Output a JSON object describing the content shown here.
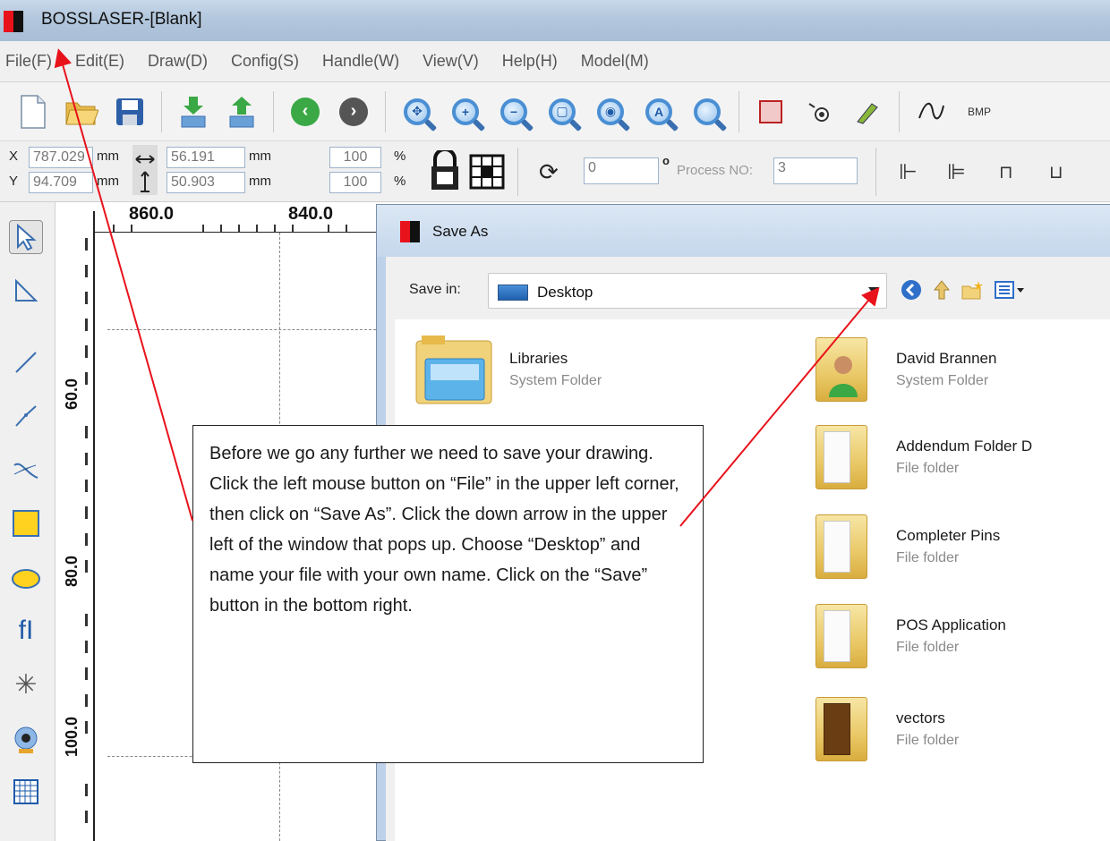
{
  "window": {
    "title": "BOSSLASER-[Blank]"
  },
  "menu": [
    "File(F)",
    "Edit(E)",
    "Draw(D)",
    "Config(S)",
    "Handle(W)",
    "View(V)",
    "Help(H)",
    "Model(M)"
  ],
  "toolbar": {
    "icons": [
      "new-file-icon",
      "open-folder-icon",
      "save-disk-icon",
      "import-icon",
      "export-icon",
      "back-arrow-icon",
      "forward-arrow-icon",
      "zoom-move-icon",
      "zoom-in-icon",
      "zoom-out-icon",
      "zoom-page-icon",
      "zoom-select-icon",
      "zoom-all-icon",
      "zoom-icon",
      "rectangle-frame-icon",
      "cursor-dot-icon",
      "pen-icon",
      "curve-icon"
    ],
    "bmp_label": "BMP"
  },
  "props": {
    "x_label": "X",
    "y_label": "Y",
    "x_value": "787.029",
    "y_value": "94.709",
    "width_value": "56.191",
    "height_value": "50.903",
    "unit": "mm",
    "scale_w": "100",
    "scale_h": "100",
    "percent": "%",
    "rotation": "0",
    "degree": "o",
    "process_label": "Process NO:",
    "process_value": "3"
  },
  "rulers": {
    "h_ticks": [
      "860.0",
      "840.0"
    ],
    "v_ticks": [
      "60.0",
      "80.0",
      "100.0"
    ]
  },
  "left_tools": [
    "select-arrow-icon",
    "node-edit-icon",
    "line-icon",
    "polyline-icon",
    "bezier-icon",
    "rectangle-icon",
    "ellipse-icon",
    "text-icon",
    "star-icon",
    "camera-icon",
    "grid-icon"
  ],
  "dialog": {
    "title": "Save As",
    "save_in_label": "Save in:",
    "save_in_value": "Desktop",
    "files": [
      {
        "name": "Libraries",
        "type": "System Folder"
      },
      {
        "name": "David Brannen",
        "type": "System Folder"
      },
      {
        "name": "Addendum Folder D",
        "type": "File folder"
      },
      {
        "name": "Completer Pins",
        "type": "File folder"
      },
      {
        "name": "POS Application",
        "type": "File folder"
      },
      {
        "name": "vectors",
        "type": "File folder"
      }
    ],
    "partial_file_type": "File folder"
  },
  "callout": {
    "text": "Before we go any further we need to save your drawing.  Click the left mouse button on “File” in the upper left corner, then click on “Save As”. Click the down arrow in the upper left of the window that pops up.  Choose “Desktop” and name your file with your own name.  Click on the “Save” button in the bottom right."
  },
  "colors": {
    "arrow": "#e8121b",
    "folder": "#e9c866",
    "accent": "#4a8fd4"
  }
}
